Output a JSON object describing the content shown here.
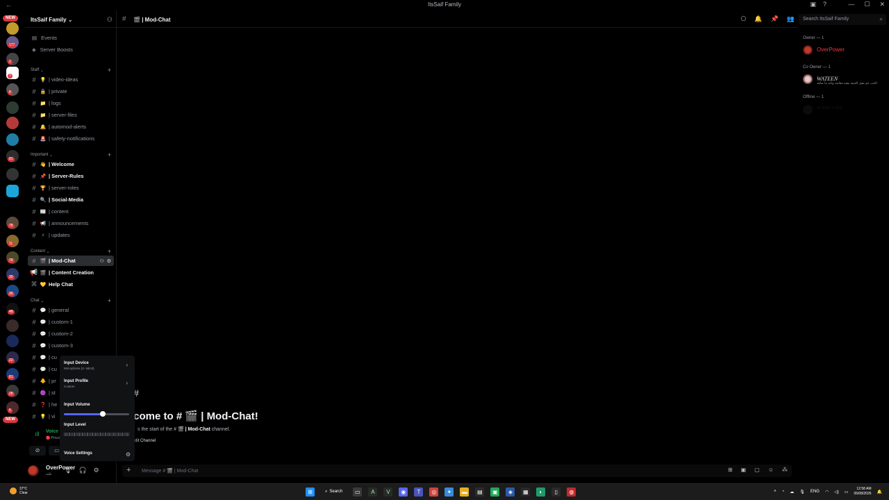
{
  "window": {
    "title": "ItsSaif Family",
    "back_glyph": "←",
    "top_icons": [
      "▣",
      "?"
    ],
    "controls": [
      "—",
      "☐",
      "✕"
    ]
  },
  "rail": {
    "new_badge_top": "NEW",
    "new_badge_bottom": "NEW",
    "badges": [
      "177",
      "2",
      "3",
      "8",
      "81",
      "78",
      "11",
      "78",
      "30",
      "36",
      "48",
      "22",
      "81",
      "28",
      "5"
    ]
  },
  "server": {
    "name": "ItsSaif Family",
    "chevron": "⌄"
  },
  "top_links": [
    {
      "icon": "▤",
      "label": "Events"
    },
    {
      "icon": "◈",
      "label": "Server Boosts"
    }
  ],
  "categories": [
    {
      "name": "Staff",
      "channels": [
        {
          "emoji": "💡",
          "label": "| video-ideas"
        },
        {
          "emoji": "🔒",
          "label": "| private"
        },
        {
          "emoji": "📁",
          "label": "| logs"
        },
        {
          "emoji": "📁",
          "label": "| server-files"
        },
        {
          "emoji": "🔔",
          "label": "| automod-alerts"
        },
        {
          "emoji": "🚨",
          "label": "| safety-notifications"
        }
      ]
    },
    {
      "name": "Important",
      "channels": [
        {
          "emoji": "👋",
          "label": "| Welcome",
          "bold": true
        },
        {
          "emoji": "📌",
          "label": "| Server-Rules",
          "bold": true
        },
        {
          "emoji": "🏆",
          "label": "| server-roles"
        },
        {
          "emoji": "🔍",
          "label": "| Social-Media",
          "bold": true
        },
        {
          "emoji": "📰",
          "label": "| content"
        },
        {
          "emoji": "📢",
          "label": "| announcements"
        },
        {
          "emoji": "⚡",
          "label": "| updates"
        }
      ]
    },
    {
      "name": "Content",
      "channels": [
        {
          "emoji": "🎬",
          "label": "| Mod-Chat",
          "active": true
        },
        {
          "emoji": "🎬",
          "label": "| Content Creation",
          "bold": true
        },
        {
          "emoji": "💛",
          "label": "Help Chat",
          "bold": true
        }
      ]
    },
    {
      "name": "Chat",
      "channels": [
        {
          "emoji": "💬",
          "label": "| general"
        },
        {
          "emoji": "💬",
          "label": "| custom-1"
        },
        {
          "emoji": "💬",
          "label": "| custom-2"
        },
        {
          "emoji": "💬",
          "label": "| custom-3"
        },
        {
          "emoji": "💬",
          "label": "| cu"
        },
        {
          "emoji": "💬",
          "label": "| cu"
        },
        {
          "emoji": "🐥",
          "label": "| pr"
        },
        {
          "emoji": "🟣",
          "label": "| st"
        },
        {
          "emoji": "❓",
          "label": "| he"
        },
        {
          "emoji": "💡",
          "label": "| vi"
        }
      ]
    }
  ],
  "voice": {
    "status": "Voice Connected",
    "channel": "🔴 Private / 1 Pers"
  },
  "user": {
    "name": "OverPower",
    "status": "عليه"
  },
  "chat": {
    "channel_name": "| Mod-Chat",
    "header_icons": [
      "⎔",
      "🔔",
      "📌",
      "👥"
    ],
    "search_placeholder": "Search ItsSaif Family",
    "welcome_title": "lcome to # 🎬 | Mod-Chat!",
    "welcome_sub_prefix": "s the start of the #",
    "welcome_sub_channel": "🎬 | Mod-Chat",
    "welcome_sub_suffix": "channel.",
    "edit_channel": "dit Channel",
    "composer_placeholder": "Message # 🎬 | Mod-Chat"
  },
  "popup": {
    "input_device_label": "Input Device",
    "input_device_value": "Microphone (2- iMic8)",
    "input_profile_label": "Input Profile",
    "input_profile_value": "Custom",
    "input_volume_label": "Input Volume",
    "input_volume_value": 0.6,
    "input_level_label": "Input Level",
    "voice_settings_label": "Voice Settings"
  },
  "members": {
    "groups": [
      {
        "title": "Owner — 1",
        "members": [
          {
            "name": "OverPower",
            "color": "#e8393f",
            "status": ""
          }
        ]
      },
      {
        "title": "Co Owner — 1",
        "members": [
          {
            "name": "WATEEN",
            "color": "#dbdee1",
            "status": "الحب عم نقيل الحينة معيد معاشد واعد ما شاقه"
          }
        ]
      },
      {
        "title": "Offline — 1",
        "members": [
          {
            "name": "ALSMC",
            "color": "#3a3c40",
            "status": "# 303"
          }
        ]
      }
    ]
  },
  "taskbar": {
    "temp": "37°C",
    "weather": "Clear",
    "search_label": "Search",
    "lang": "ENG",
    "time": "12:58 AM",
    "date": "05/08/2026"
  },
  "colors": {
    "accent": "#5865f2",
    "online_green": "#23a55a",
    "owner_red": "#e8393f",
    "badge_red": "#da373c"
  }
}
